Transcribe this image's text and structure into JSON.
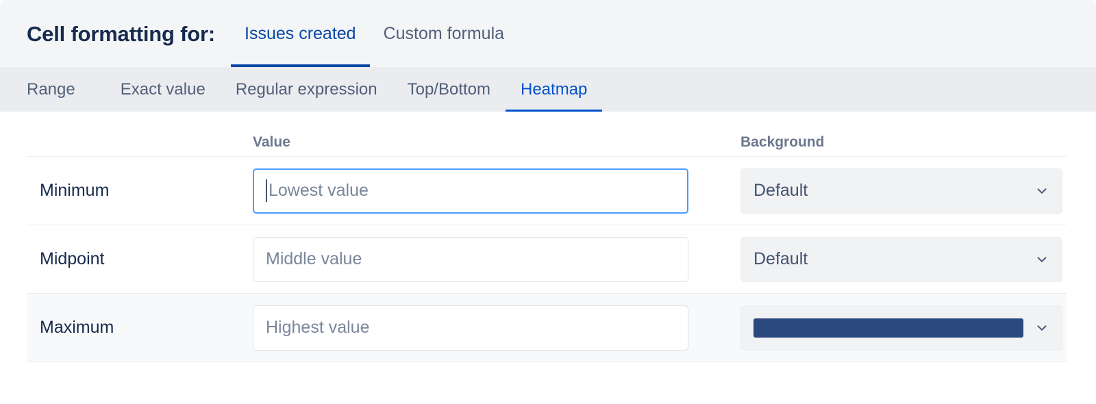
{
  "header": {
    "title": "Cell formatting for:",
    "tabs": [
      {
        "label": "Issues created",
        "active": true
      },
      {
        "label": "Custom formula",
        "active": false
      }
    ]
  },
  "tabstrip": {
    "tabs": [
      {
        "label": "Range",
        "active": false
      },
      {
        "label": "Exact value",
        "active": false
      },
      {
        "label": "Regular expression",
        "active": false
      },
      {
        "label": "Top/Bottom",
        "active": false
      },
      {
        "label": "Heatmap",
        "active": true
      }
    ]
  },
  "table": {
    "columns": {
      "label": "",
      "value": "Value",
      "background": "Background"
    },
    "rows": [
      {
        "label": "Minimum",
        "value": "",
        "placeholder": "Lowest value",
        "focused": true,
        "background_label": "Default",
        "background_color": null,
        "highlight": false
      },
      {
        "label": "Midpoint",
        "value": "",
        "placeholder": "Middle value",
        "focused": false,
        "background_label": "Default",
        "background_color": null,
        "highlight": false
      },
      {
        "label": "Maximum",
        "value": "",
        "placeholder": "Highest value",
        "focused": false,
        "background_label": "",
        "background_color": "#2a4a7d",
        "highlight": true
      }
    ]
  },
  "colors": {
    "accent": "#0052cc",
    "accent_dark": "#0747a6",
    "focus_ring": "#4c9aff",
    "header_bg": "#f4f5f7",
    "tabstrip_bg": "#ebecf0",
    "text": "#172b4d",
    "muted_text": "#6b778c",
    "max_swatch": "#2a4a7d"
  },
  "icons": {
    "chevron_down": "chevron-down-icon"
  }
}
